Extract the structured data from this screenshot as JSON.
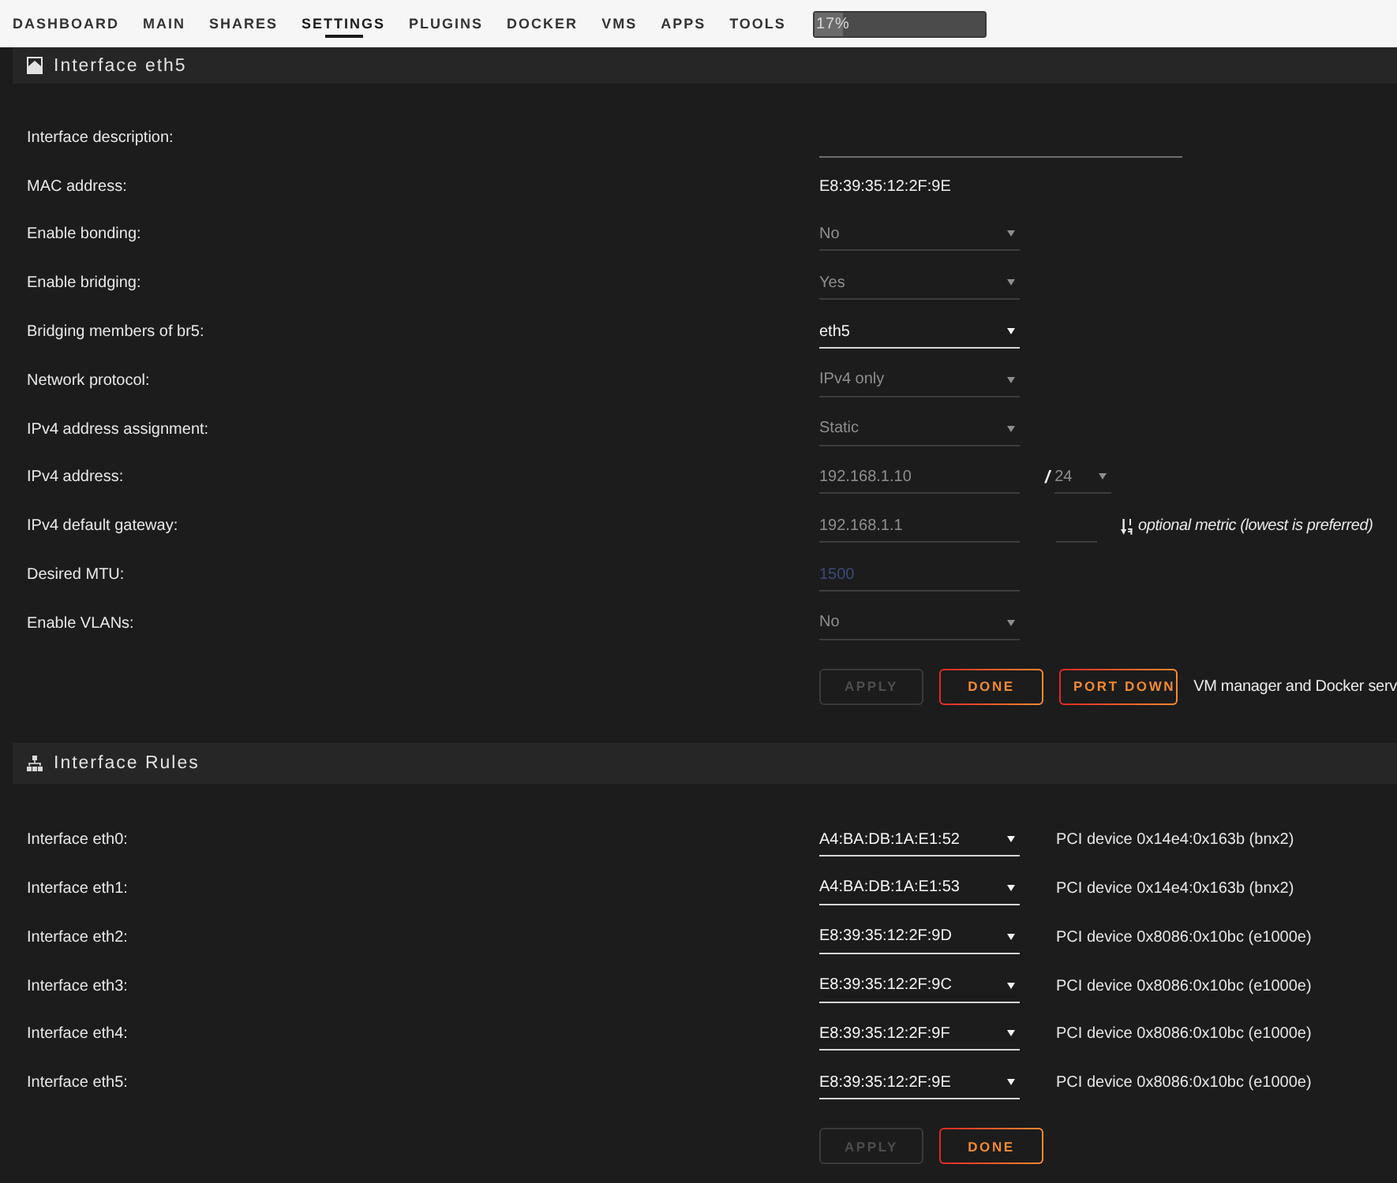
{
  "nav": {
    "items": [
      {
        "label": "DASHBOARD",
        "selected": false
      },
      {
        "label": "MAIN",
        "selected": false
      },
      {
        "label": "SHARES",
        "selected": false
      },
      {
        "label": "SETTINGS",
        "selected": true
      },
      {
        "label": "PLUGINS",
        "selected": false
      },
      {
        "label": "DOCKER",
        "selected": false
      },
      {
        "label": "VMS",
        "selected": false
      },
      {
        "label": "APPS",
        "selected": false
      },
      {
        "label": "TOOLS",
        "selected": false
      }
    ],
    "progress": {
      "label": "17%",
      "level": 0.17
    }
  },
  "sections": [
    {
      "kind": "interface",
      "title": "Interface eth5",
      "fields": [
        {
          "kind": "textline",
          "label": "Interface description:",
          "disabled": false
        },
        {
          "kind": "text",
          "label": "MAC address:",
          "value": "E8:39:35:12:2F:9E"
        },
        {
          "kind": "select",
          "label": "Enable bonding:",
          "value": "No",
          "disabled": true
        },
        {
          "kind": "select",
          "label": "Enable bridging:",
          "value": "Yes",
          "disabled": true
        },
        {
          "kind": "select",
          "label": "Bridging members of br5:",
          "value": "eth5",
          "disabled": false
        },
        {
          "kind": "select",
          "label": "Network protocol:",
          "value": "IPv4 only",
          "disabled": true
        },
        {
          "kind": "select",
          "label": "IPv4 address assignment:",
          "value": "Static",
          "disabled": true
        },
        {
          "kind": "ip",
          "label": "IPv4 address:",
          "value": "192.168.1.10",
          "separator": "/",
          "prefix": "24",
          "disabled": true
        },
        {
          "kind": "gateway",
          "label": "IPv4 default gateway:",
          "value": "192.168.1.1",
          "note": "optional metric (lowest is preferred)",
          "disabled": true
        },
        {
          "kind": "input",
          "label": "Desired MTU:",
          "placeholder": "1500",
          "disabled": true
        },
        {
          "kind": "select",
          "label": "Enable VLANs:",
          "value": "No",
          "disabled": true
        }
      ],
      "buttons": [
        {
          "label": "APPLY",
          "disabled": true
        },
        {
          "label": "DONE",
          "disabled": false
        },
        {
          "label": "PORT DOWN",
          "disabled": false
        }
      ],
      "note": "VM manager and Docker serv"
    },
    {
      "kind": "rules",
      "title": "Interface Rules",
      "rows": [
        {
          "label": "Interface eth0:",
          "value": "A4:BA:DB:1A:E1:52",
          "device": "PCI device 0x14e4:0x163b (bnx2)"
        },
        {
          "label": "Interface eth1:",
          "value": "A4:BA:DB:1A:E1:53",
          "device": "PCI device 0x14e4:0x163b (bnx2)"
        },
        {
          "label": "Interface eth2:",
          "value": "E8:39:35:12:2F:9D",
          "device": "PCI device 0x8086:0x10bc (e1000e)"
        },
        {
          "label": "Interface eth3:",
          "value": "E8:39:35:12:2F:9C",
          "device": "PCI device 0x8086:0x10bc (e1000e)"
        },
        {
          "label": "Interface eth4:",
          "value": "E8:39:35:12:2F:9F",
          "device": "PCI device 0x8086:0x10bc (e1000e)"
        },
        {
          "label": "Interface eth5:",
          "value": "E8:39:35:12:2F:9E",
          "device": "PCI device 0x8086:0x10bc (e1000e)"
        }
      ],
      "buttons": [
        {
          "label": "APPLY",
          "disabled": true
        },
        {
          "label": "DONE",
          "disabled": false
        }
      ]
    }
  ]
}
